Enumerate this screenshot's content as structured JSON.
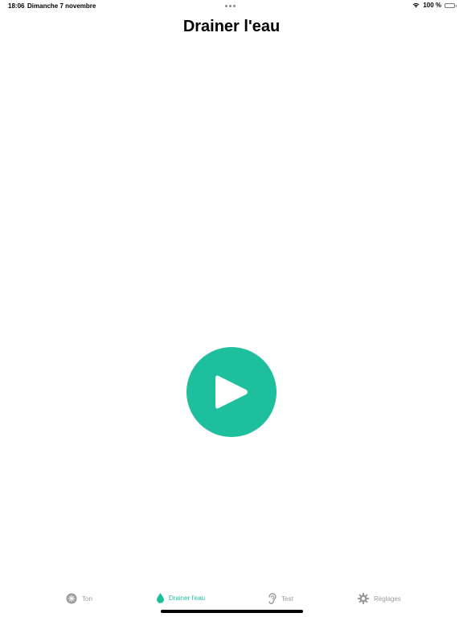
{
  "status_bar": {
    "time": "18:06",
    "date": "Dimanche 7 novembre",
    "battery_text": "100 %",
    "wifi_icon": "wifi-icon",
    "battery_icon": "battery-full-icon"
  },
  "header": {
    "title": "Drainer l'eau"
  },
  "main": {
    "play_button_icon": "play-icon",
    "accent_color": "#1dbf9c"
  },
  "tab_bar": {
    "active_color": "#1dbf9c",
    "inactive_color": "#9b9b9b",
    "items": [
      {
        "label": "Ton",
        "icon": "tone-icon",
        "active": false
      },
      {
        "label": "Drainer l'eau",
        "icon": "water-drop-icon",
        "active": true
      },
      {
        "label": "Test",
        "icon": "ear-icon",
        "active": false
      },
      {
        "label": "Réglages",
        "icon": "gear-icon",
        "active": false
      }
    ]
  }
}
